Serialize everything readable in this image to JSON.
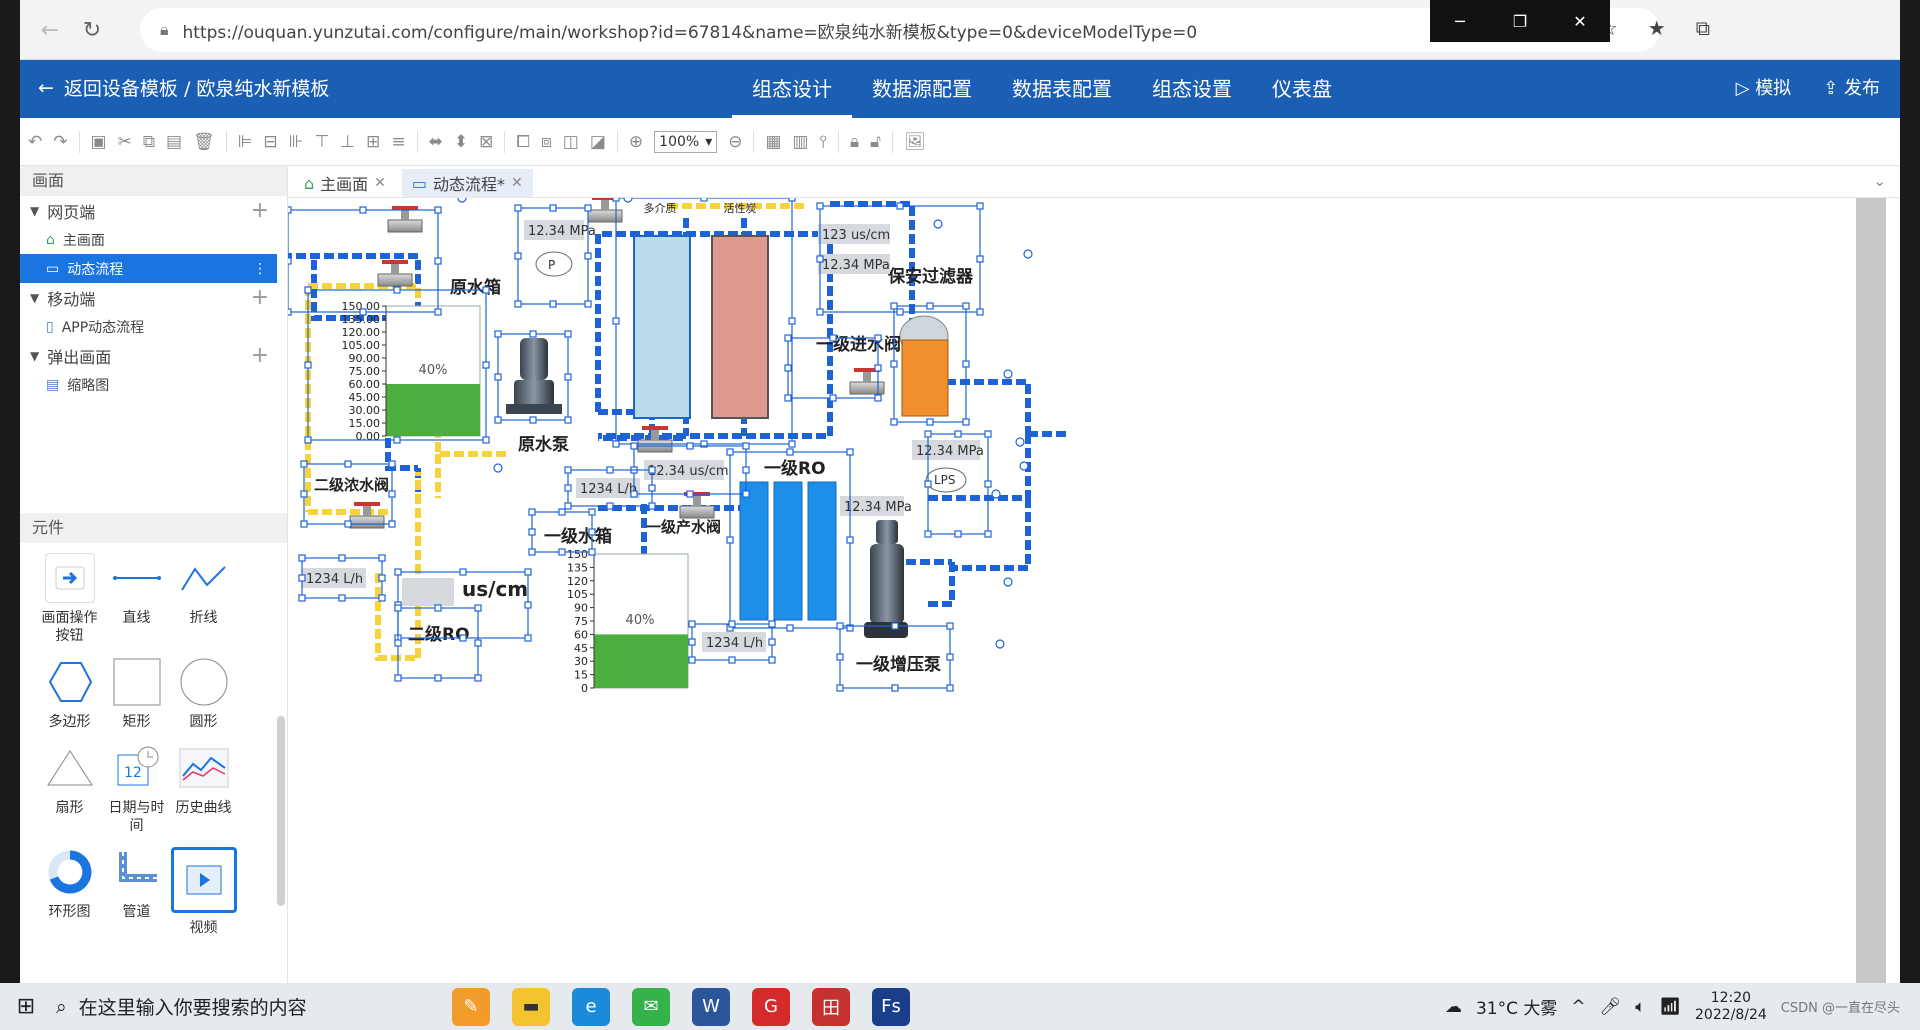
{
  "browser": {
    "url": "https://ouquan.yunzutai.com/configure/main/workshop?id=67814&name=欧泉纯水新模板&type=0&deviceModelType=0"
  },
  "appbar": {
    "back_label": "返回设备模板 /  欧泉纯水新模板",
    "tabs": [
      {
        "label": "组态设计"
      },
      {
        "label": "数据源配置"
      },
      {
        "label": "数据表配置"
      },
      {
        "label": "组态设置"
      },
      {
        "label": "仪表盘"
      }
    ],
    "simulate_label": "模拟",
    "publish_label": "发布"
  },
  "toolbar": {
    "zoom": "100%"
  },
  "sidebar": {
    "screens_header": "画面",
    "groups": [
      {
        "label": "网页端",
        "items": [
          {
            "label": "主画面"
          },
          {
            "label": "动态流程"
          }
        ]
      },
      {
        "label": "移动端",
        "items": [
          {
            "label": "APP动态流程"
          }
        ]
      },
      {
        "label": "弹出画面",
        "items": [
          {
            "label": "缩略图"
          }
        ]
      }
    ],
    "components_header": "元件",
    "components": [
      {
        "label": "画面操作按钮"
      },
      {
        "label": "直线"
      },
      {
        "label": "折线"
      },
      {
        "label": "多边形"
      },
      {
        "label": "矩形"
      },
      {
        "label": "圆形"
      },
      {
        "label": "扇形"
      },
      {
        "label": "日期与时间"
      },
      {
        "label": "历史曲线"
      },
      {
        "label": "环形图"
      },
      {
        "label": "管道"
      },
      {
        "label": "视频"
      }
    ]
  },
  "doc_tabs": [
    {
      "label": "主画面"
    },
    {
      "label": "动态流程*"
    }
  ],
  "diagram": {
    "labels": {
      "raw_tank": "原水箱",
      "raw_pump": "原水泵",
      "secondary_conc_valve": "二级浓水阀",
      "secondary_ro": "二级RO",
      "unit_uscm": "us/cm",
      "primary_tank": "一级水箱",
      "primary_product_valve": "一级产水阀",
      "primary_ro": "一级RO",
      "primary_booster": "一级增压泵",
      "primary_inlet_valve": "一级进水阀",
      "security_filter": "保安过滤器",
      "multi_media": "多介质",
      "activated_carbon": "活性炭"
    },
    "readings": {
      "p1": "12.34 MPa",
      "cond1": "123 us/cm",
      "p2": "12.34 MPa",
      "p3": "12.34 MPa",
      "cond2": "12.34 us/cm",
      "flow1": "1234 L/h",
      "p4": "12.34 MPa",
      "flow2": "1234 L/h",
      "flow3": "1234 L/h",
      "lps": "LPS",
      "dot": "P"
    },
    "tank1": {
      "level_label": "40%",
      "level": 0.4,
      "scale": [
        "150.00",
        "135.00",
        "120.00",
        "105.00",
        "90.00",
        "75.00",
        "60.00",
        "45.00",
        "30.00",
        "15.00",
        "0.00"
      ]
    },
    "tank2": {
      "level_label": "40%",
      "level": 0.4,
      "scale": [
        "150",
        "135",
        "120",
        "105",
        "90",
        "75",
        "60",
        "45",
        "30",
        "15",
        "0"
      ]
    }
  },
  "taskbar": {
    "search_placeholder": "在这里输入你要搜索的内容",
    "weather": "31°C  大雾",
    "time": "12:20",
    "date": "2022/8/24",
    "watermark": "CSDN @一直在尽头"
  }
}
